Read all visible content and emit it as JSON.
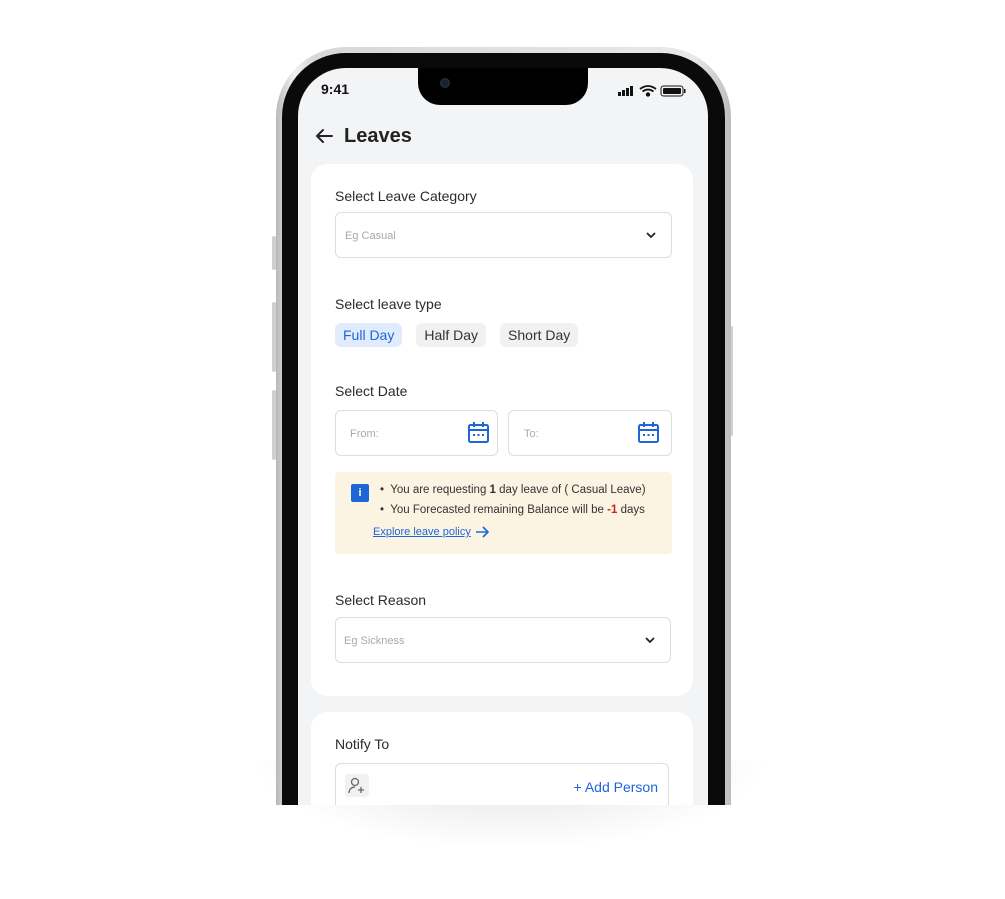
{
  "status_bar": {
    "time": "9:41"
  },
  "header": {
    "title": "Leaves",
    "back_icon": "arrow-left-icon"
  },
  "form": {
    "category": {
      "label": "Select Leave Category",
      "placeholder": "Eg Casual"
    },
    "leave_type": {
      "label": "Select leave type",
      "options": [
        {
          "label": "Full Day",
          "selected": true
        },
        {
          "label": "Half Day",
          "selected": false
        },
        {
          "label": "Short Day",
          "selected": false
        }
      ]
    },
    "date": {
      "label": "Select Date",
      "from_placeholder": "From:",
      "to_placeholder": "To:"
    },
    "notice": {
      "line1_pre": "You are requesting ",
      "line1_bold": "1",
      "line1_post": " day leave of ( Casual Leave)",
      "line2_pre": "You Forecasted remaining Balance will be ",
      "line2_value": "-1",
      "line2_post": " days",
      "link": "Explore leave policy"
    },
    "reason": {
      "label": "Select Reason",
      "placeholder": "Eg Sickness"
    }
  },
  "notify": {
    "label": "Notify To",
    "add_label": "+ Add Person"
  },
  "colors": {
    "accent": "#1e66d8",
    "negative": "#d32020",
    "notice_bg": "#fcf4e3",
    "selected_chip_bg": "#e0ecfd"
  }
}
